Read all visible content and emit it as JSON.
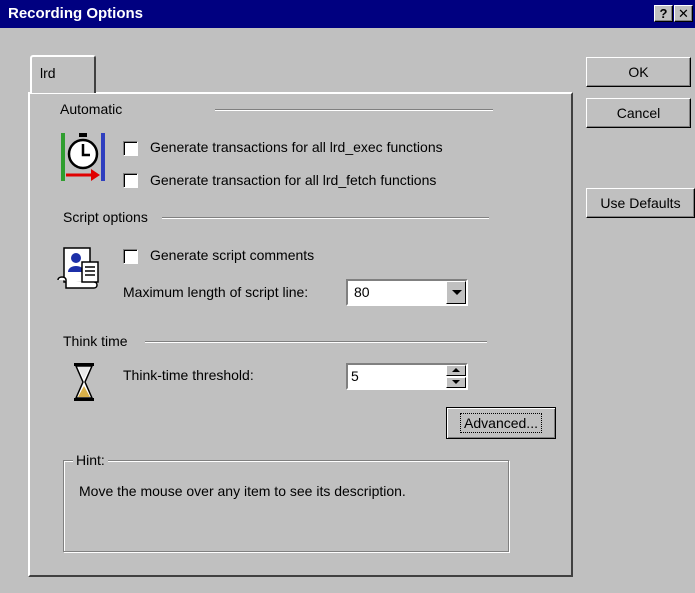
{
  "window": {
    "title": "Recording Options",
    "help_glyph": "?",
    "close_glyph": "✕"
  },
  "tab": {
    "label": "lrd"
  },
  "buttons": {
    "ok": "OK",
    "cancel": "Cancel",
    "use_defaults": "Use Defaults",
    "advanced": "Advanced..."
  },
  "automatic": {
    "heading": "Automatic",
    "icon": "stopwatch-transaction-icon",
    "options": [
      {
        "label": "Generate transactions for all lrd_exec functions",
        "checked": false
      },
      {
        "label": "Generate transaction for all lrd_fetch functions",
        "checked": false
      }
    ]
  },
  "script_options": {
    "heading": "Script options",
    "icon": "script-document-icon",
    "comments_label": "Generate script comments",
    "comments_checked": false,
    "max_length_label": "Maximum length of script line:",
    "max_length_value": "80"
  },
  "think_time": {
    "heading": "Think time",
    "icon": "hourglass-icon",
    "threshold_label": "Think-time threshold:",
    "threshold_value": "5"
  },
  "hint": {
    "title": "Hint:",
    "text": "Move the mouse over any item to see its description."
  },
  "colors": {
    "titlebar": "#000080",
    "face": "#c0c0c0"
  }
}
